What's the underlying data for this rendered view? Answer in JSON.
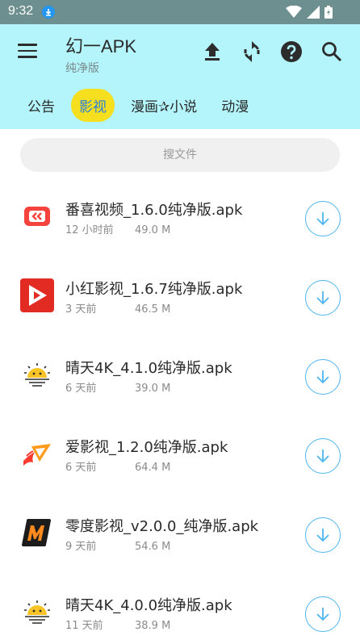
{
  "status_bar": {
    "time": "9:32"
  },
  "app_bar": {
    "title": "幻一APK",
    "subtitle": "纯净版",
    "tabs": [
      {
        "label": "公告",
        "active": false
      },
      {
        "label": "影视",
        "active": true
      },
      {
        "label": "漫画✰小说",
        "active": false
      },
      {
        "label": "动漫",
        "active": false
      }
    ]
  },
  "search": {
    "placeholder": "搜文件"
  },
  "files": [
    {
      "icon": "fanxi-app-icon",
      "name": "番喜视频_1.6.0纯净版.apk",
      "time": "12 小时前",
      "size": "49.0 M"
    },
    {
      "icon": "xiaohong-app-icon",
      "name": "小红影视_1.6.7纯净版.apk",
      "time": "3 天前",
      "size": "46.5 M"
    },
    {
      "icon": "qingtian-app-icon",
      "name": "晴天4K_4.1.0纯净版.apk",
      "time": "6 天前",
      "size": "39.0 M"
    },
    {
      "icon": "ai-app-icon",
      "name": "爱影视_1.2.0纯净版.apk",
      "time": "6 天前",
      "size": "64.4 M"
    },
    {
      "icon": "lingdu-app-icon",
      "name": "零度影视_v2.0.0_纯净版.apk",
      "time": "9 天前",
      "size": "54.6 M"
    },
    {
      "icon": "qingtian-app-icon",
      "name": "晴天4K_4.0.0纯净版.apk",
      "time": "11 天前",
      "size": "38.9 M"
    }
  ],
  "colors": {
    "app_bar": "#b3f5fb",
    "active_tab": "#f5df1e",
    "active_tab_text": "#2c7fdc",
    "download_ring": "#4fb6f0"
  }
}
